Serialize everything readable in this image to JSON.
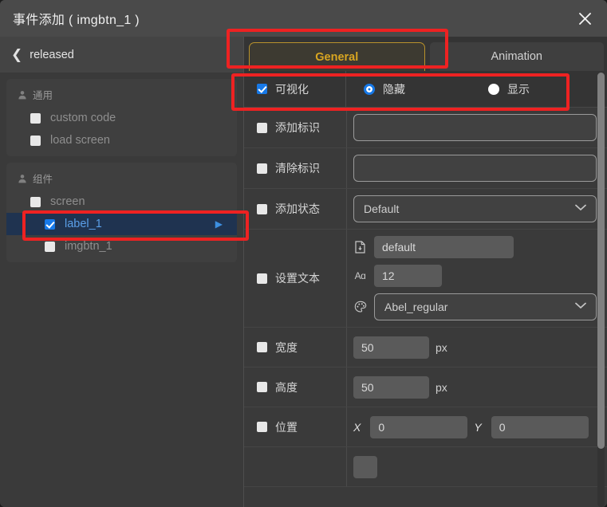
{
  "window": {
    "title": "事件添加 ( imgbtn_1 )",
    "close_icon": "close-icon"
  },
  "left_panel": {
    "backnav": {
      "label": "released",
      "icon": "chevron-left-icon"
    },
    "groups": [
      {
        "header": "通用",
        "header_icon": "user-icon",
        "items": [
          {
            "label": "custom code",
            "checked": false,
            "indent": 1,
            "selected": false
          },
          {
            "label": "load screen",
            "checked": false,
            "indent": 1,
            "selected": false
          }
        ]
      },
      {
        "header": "组件",
        "header_icon": "user-icon",
        "items": [
          {
            "label": "screen",
            "checked": false,
            "indent": 1,
            "selected": false
          },
          {
            "label": "label_1",
            "checked": true,
            "indent": 2,
            "selected": true,
            "arrow": "▶"
          },
          {
            "label": "imgbtn_1",
            "checked": false,
            "indent": 2,
            "selected": false
          }
        ]
      }
    ]
  },
  "right_panel": {
    "tabs": [
      {
        "label": "General",
        "active": true
      },
      {
        "label": "Animation",
        "active": false
      }
    ],
    "visibility_row": {
      "checkbox_label": "可视化",
      "checkbox_checked": true,
      "radios": [
        {
          "label": "隐藏",
          "selected": true
        },
        {
          "label": "显示",
          "selected": false
        }
      ]
    },
    "rows": [
      {
        "label": "添加标识",
        "checked": false,
        "control": "text",
        "value": "",
        "placeholder": ""
      },
      {
        "label": "清除标识",
        "checked": false,
        "control": "text",
        "value": "",
        "placeholder": ""
      },
      {
        "label": "添加状态",
        "checked": false,
        "control": "select",
        "value": "Default",
        "chevron": "chevron-down-icon"
      },
      {
        "label": "设置文本",
        "checked": false,
        "control": "text-group",
        "lines": [
          {
            "icon": "document-icon",
            "value": "default",
            "style": "flat"
          },
          {
            "icon": "font-size-icon",
            "value": "12",
            "style": "flat"
          },
          {
            "icon": "palette-icon",
            "value": "Abel_regular",
            "style": "select",
            "chevron": "chevron-down-icon"
          }
        ]
      },
      {
        "label": "宽度",
        "checked": false,
        "control": "number-unit",
        "value": "50",
        "unit": "px"
      },
      {
        "label": "高度",
        "checked": false,
        "control": "number-unit",
        "value": "50",
        "unit": "px"
      },
      {
        "label": "位置",
        "checked": false,
        "control": "xy",
        "x_label": "X",
        "x_value": "0",
        "y_label": "Y",
        "y_value": "0"
      }
    ]
  },
  "annotations": {
    "accent_red": "#ee2222",
    "boxes": [
      "general-tab",
      "visibility-row",
      "tree-item-label_1"
    ]
  },
  "colors": {
    "window_bg": "#3a3a3a",
    "titlebar_bg": "#4a4a4a",
    "tab_active_text": "#d8a521",
    "tab_active_border": "#b8912c",
    "selection_bg": "#1f3350",
    "selection_text": "#5b9fe8",
    "checkbox_checked": "#1779e8",
    "annotation": "#ee2222"
  }
}
